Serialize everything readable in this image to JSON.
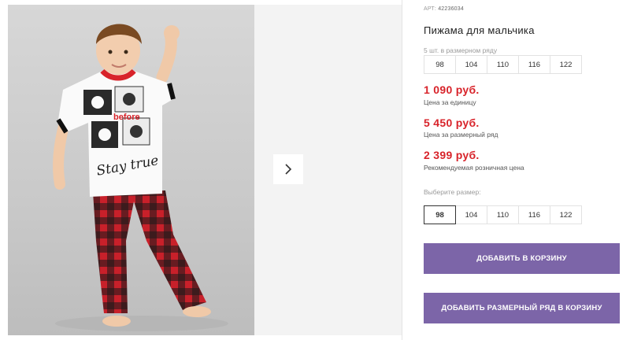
{
  "product": {
    "sku_label": "АРТ:",
    "sku_value": "42236034",
    "title": "Пижама для мальчика"
  },
  "size_row": {
    "note": "5 шт. в размерном ряду",
    "sizes": [
      "98",
      "104",
      "110",
      "116",
      "122"
    ]
  },
  "prices": {
    "unit": {
      "value": "1 090 руб.",
      "label": "Цена за единицу"
    },
    "row": {
      "value": "5 450 руб.",
      "label": "Цена за размерный ряд"
    },
    "retail": {
      "value": "2 399 руб.",
      "label": "Рекомендуемая розничная цена"
    }
  },
  "size_select": {
    "label": "Выберите размер:",
    "sizes": [
      "98",
      "104",
      "110",
      "116",
      "122"
    ],
    "selected": "98"
  },
  "buttons": {
    "add_to_cart": "ДОБАВИТЬ В КОРЗИНУ",
    "add_row_to_cart": "ДОБАВИТЬ РАЗМЕРНЫЙ РЯД В КОРЗИНУ"
  },
  "print_text": {
    "line1": "before",
    "line2": "Stay true"
  },
  "colors": {
    "price": "#d8232a",
    "button": "#7c65a8",
    "pajama_red": "#c8202a"
  },
  "icons": {
    "next": "chevron-right-icon"
  }
}
